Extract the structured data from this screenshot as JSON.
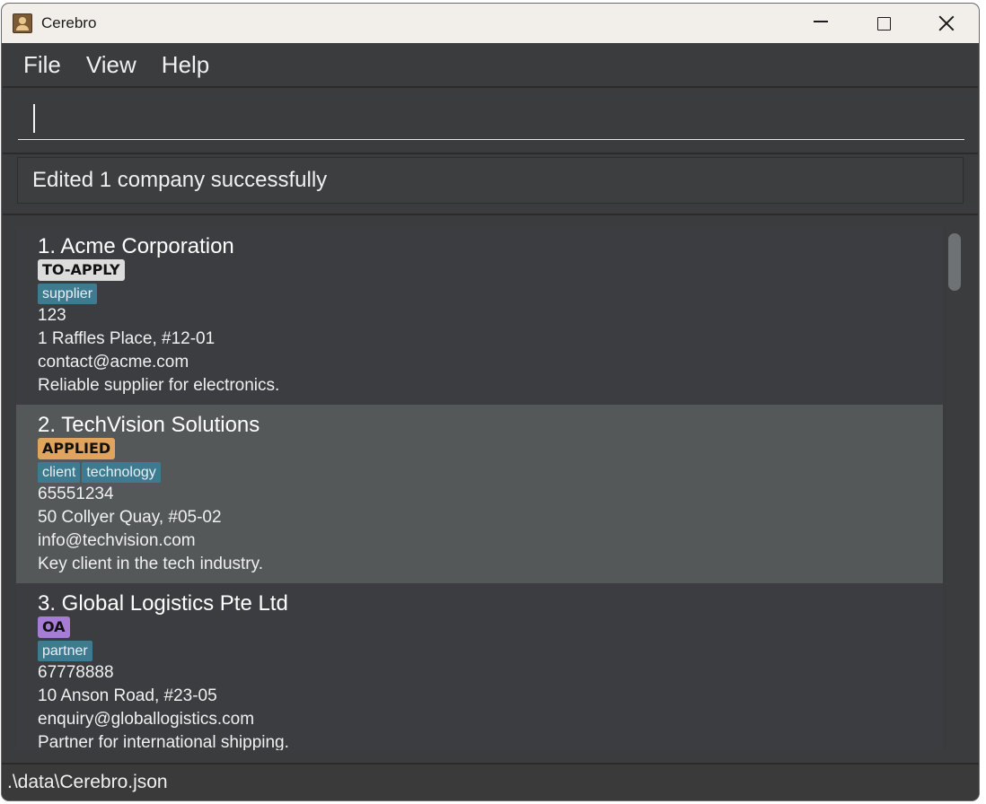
{
  "window": {
    "title": "Cerebro"
  },
  "menu": [
    "File",
    "View",
    "Help"
  ],
  "command_box": {
    "value": "",
    "placeholder": ""
  },
  "result_message": "Edited 1 company successfully",
  "companies": [
    {
      "name": "1. Acme Corporation",
      "status": "TO-APPLY",
      "status_color": "#dcdcdc",
      "tags": [
        "supplier"
      ],
      "phone": "123",
      "address": "1 Raffles Place, #12-01",
      "email": "contact@acme.com",
      "remark": "Reliable supplier for electronics.",
      "selected": false
    },
    {
      "name": "2. TechVision Solutions",
      "status": "APPLIED",
      "status_color": "#e0a45e",
      "tags": [
        "client",
        "technology"
      ],
      "phone": "65551234",
      "address": "50 Collyer Quay, #05-02",
      "email": "info@techvision.com",
      "remark": "Key client in the tech industry.",
      "selected": true
    },
    {
      "name": "3. Global Logistics Pte Ltd",
      "status": "OA",
      "status_color": "#a77cd6",
      "tags": [
        "partner"
      ],
      "phone": "67778888",
      "address": "10 Anson Road, #23-05",
      "email": "enquiry@globallogistics.com",
      "remark": "Partner for international shipping.",
      "selected": false
    }
  ],
  "storage_path": ".\\data\\Cerebro.json",
  "colors": {
    "window_bg": "#3b3c3d",
    "tag_bg": "#3e7b91",
    "selected_row": "#545859",
    "titlebar": "#f2efea"
  }
}
